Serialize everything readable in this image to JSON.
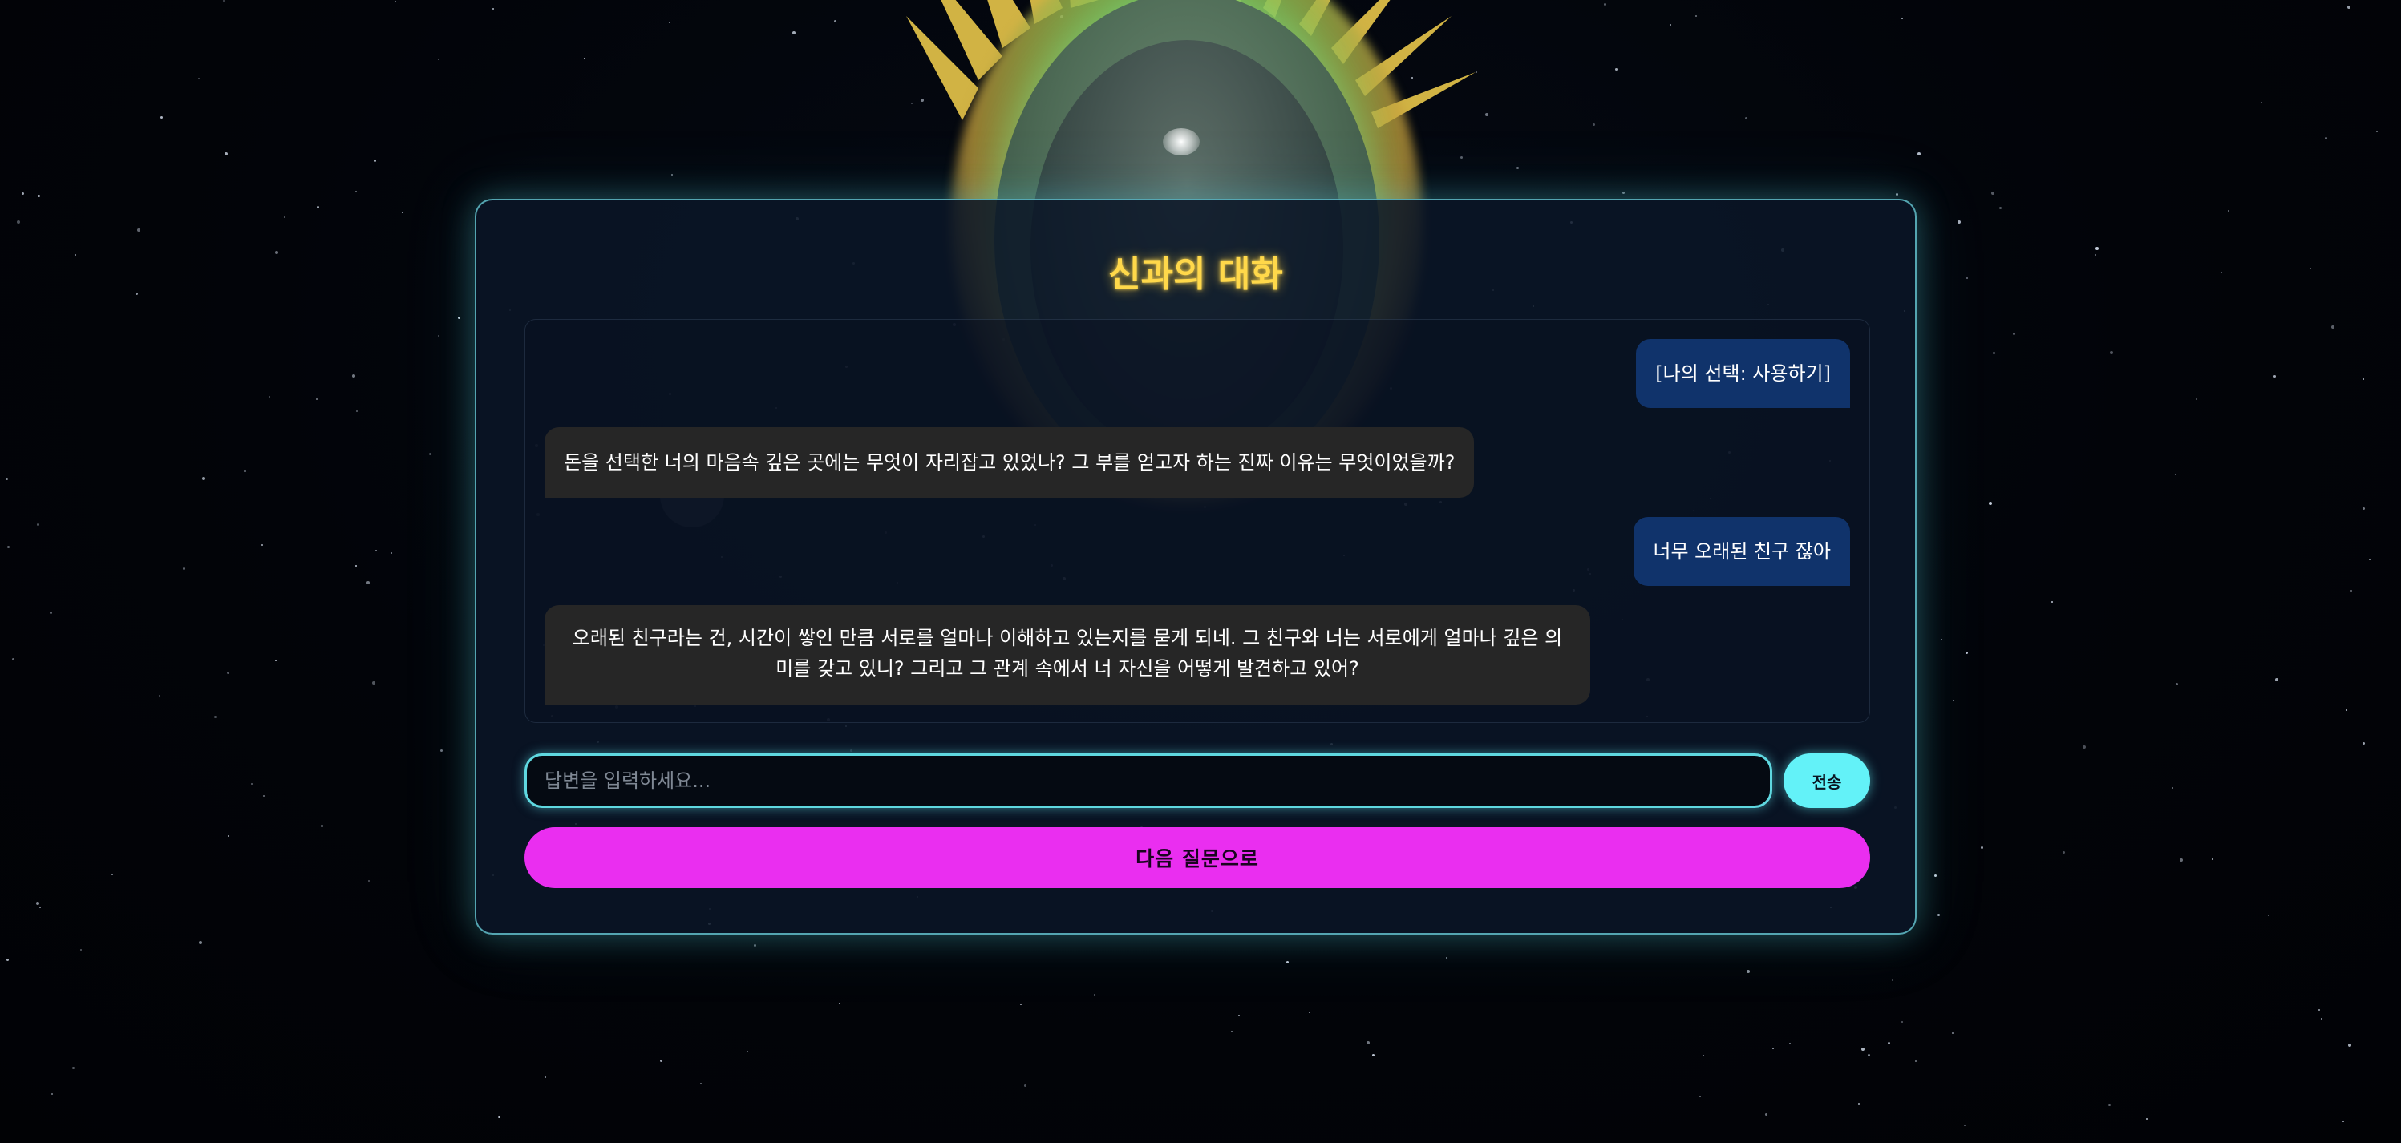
{
  "page": {
    "title": "신과의 대화"
  },
  "chat": {
    "messages": [
      {
        "role": "user",
        "text": "[나의 선택: 사용하기]"
      },
      {
        "role": "god",
        "text": "돈을 선택한 너의 마음속 깊은 곳에는 무엇이 자리잡고 있었나? 그 부를 얻고자 하는 진짜 이유는 무엇이었을까?"
      },
      {
        "role": "user",
        "text": "너무 오래된 친구 잖아"
      },
      {
        "role": "god",
        "text": "오래된 친구라는 건, 시간이 쌓인 만큼 서로를 얼마나 이해하고 있는지를 묻게 되네. 그 친구와 너는 서로에게 얼마나 깊은 의미를 갖고 있니? 그리고 그 관계 속에서 너 자신을 어떻게 발견하고 있어?"
      }
    ]
  },
  "input": {
    "placeholder": "답변을 입력하세요...",
    "value": "",
    "send_label": "전송"
  },
  "actions": {
    "next_label": "다음 질문으로"
  },
  "colors": {
    "accent_title": "#ffd84a",
    "border_glow": "#5fd8e0",
    "send_button": "#63f2f8",
    "next_button": "#ea2ef0",
    "user_bubble": "#10336b",
    "god_bubble": "#262626"
  }
}
